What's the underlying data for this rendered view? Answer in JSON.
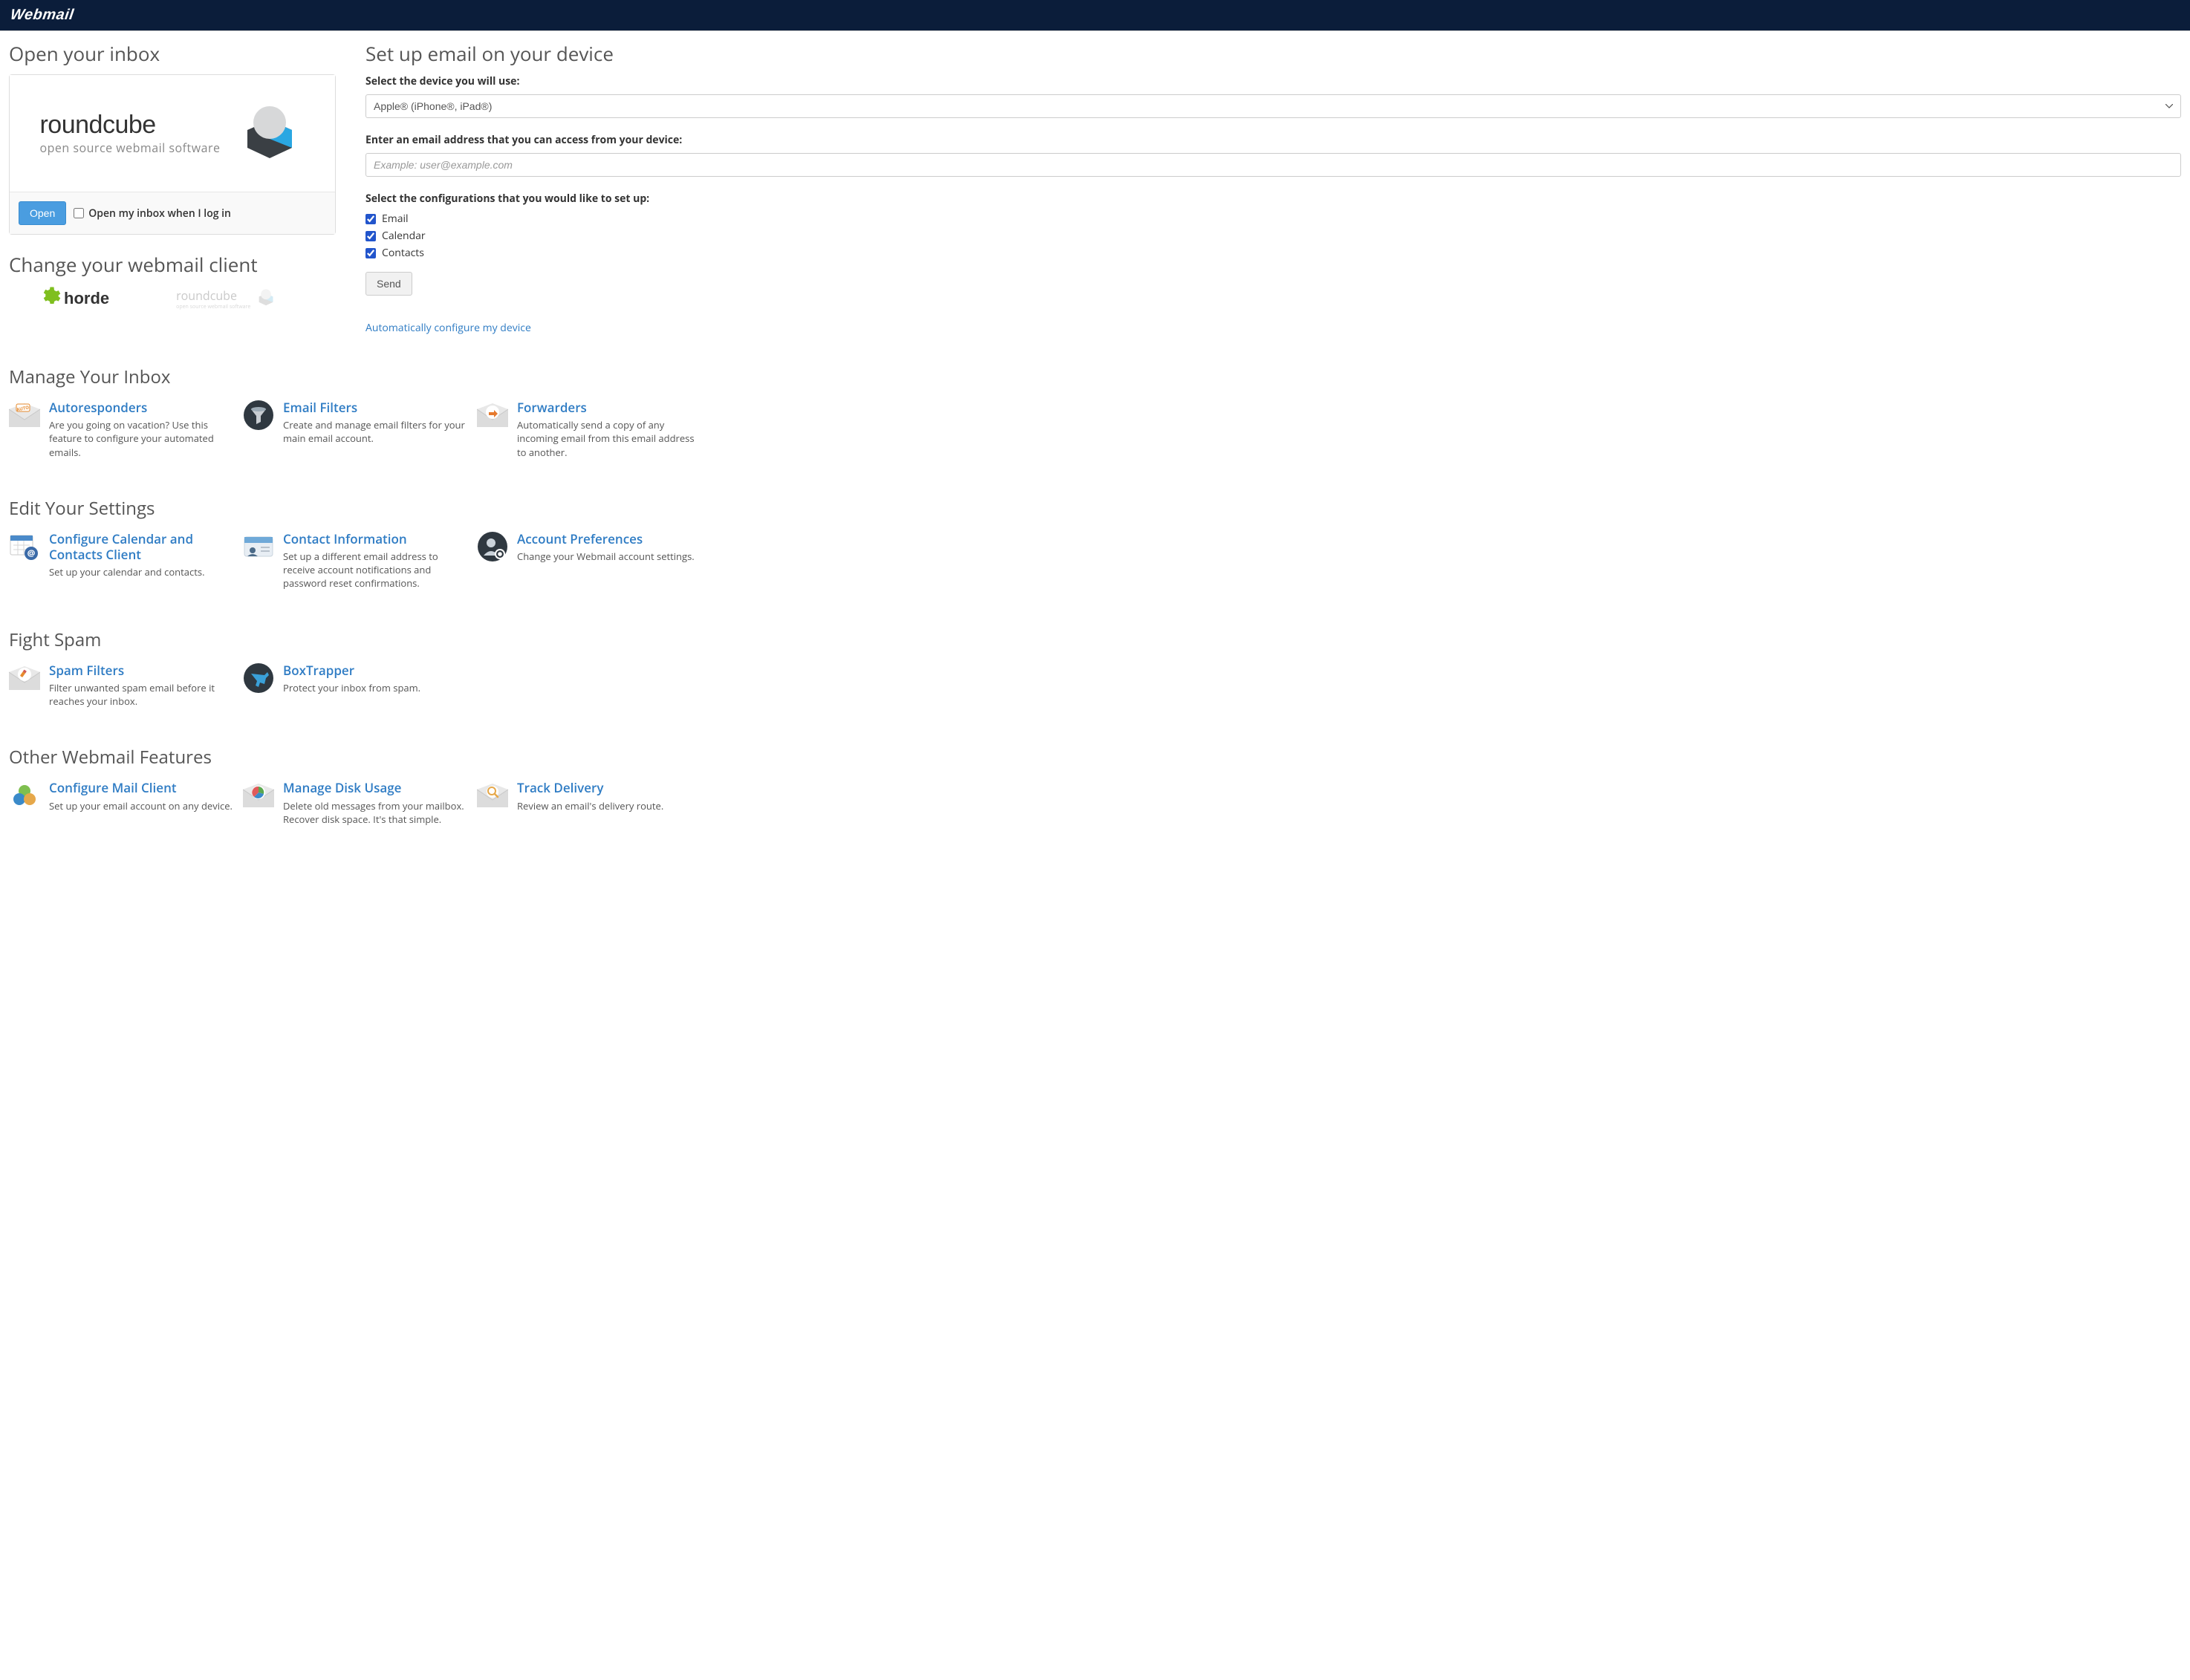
{
  "brand": "Webmail",
  "open_inbox": {
    "heading": "Open your inbox",
    "logo_title": "roundcube",
    "logo_subtitle": "open source webmail software",
    "open_button": "Open",
    "auto_open_label": "Open my inbox when I log in"
  },
  "change_client": {
    "heading": "Change your webmail client",
    "clients": [
      {
        "name": "horde"
      },
      {
        "name": "roundcube",
        "subtitle": "open source webmail software"
      }
    ]
  },
  "setup": {
    "heading": "Set up email on your device",
    "device_label": "Select the device you will use:",
    "device_value": "Apple® (iPhone®, iPad®)",
    "email_label": "Enter an email address that you can access from your device:",
    "email_placeholder": "Example: user@example.com",
    "config_label": "Select the configurations that you would like to set up:",
    "options": {
      "email": "Email",
      "calendar": "Calendar",
      "contacts": "Contacts"
    },
    "send_button": "Send",
    "auto_link": "Automatically configure my device"
  },
  "sections": [
    {
      "title": "Manage Your Inbox",
      "features": [
        {
          "icon": "auto-envelope",
          "title": "Autoresponders",
          "desc": "Are you going on vacation? Use this feature to configure your automated emails."
        },
        {
          "icon": "funnel",
          "title": "Email Filters",
          "desc": "Create and manage email filters for your main email account."
        },
        {
          "icon": "forward-env",
          "title": "Forwarders",
          "desc": "Automatically send a copy of any incoming email from this email address to another."
        }
      ]
    },
    {
      "title": "Edit Your Settings",
      "features": [
        {
          "icon": "calendar-at",
          "title": "Configure Calendar and Contacts Client",
          "desc": "Set up your calendar and contacts."
        },
        {
          "icon": "contact-card",
          "title": "Contact Information",
          "desc": "Set up a different email address to receive account notifications and password reset confirmations."
        },
        {
          "icon": "user-gear",
          "title": "Account Preferences",
          "desc": "Change your Webmail account settings."
        }
      ]
    },
    {
      "title": "Fight Spam",
      "features": [
        {
          "icon": "pencil-env",
          "title": "Spam Filters",
          "desc": "Filter unwanted spam email before it reaches your inbox."
        },
        {
          "icon": "raygun",
          "title": "BoxTrapper",
          "desc": "Protect your inbox from spam."
        }
      ]
    },
    {
      "title": "Other Webmail Features",
      "features": [
        {
          "icon": "tricolor",
          "title": "Configure Mail Client",
          "desc": "Set up your email account on any device."
        },
        {
          "icon": "pie-env",
          "title": "Manage Disk Usage",
          "desc": "Delete old messages from your mailbox. Recover disk space. It's that simple."
        },
        {
          "icon": "search-env",
          "title": "Track Delivery",
          "desc": "Review an email's delivery route."
        }
      ]
    }
  ]
}
